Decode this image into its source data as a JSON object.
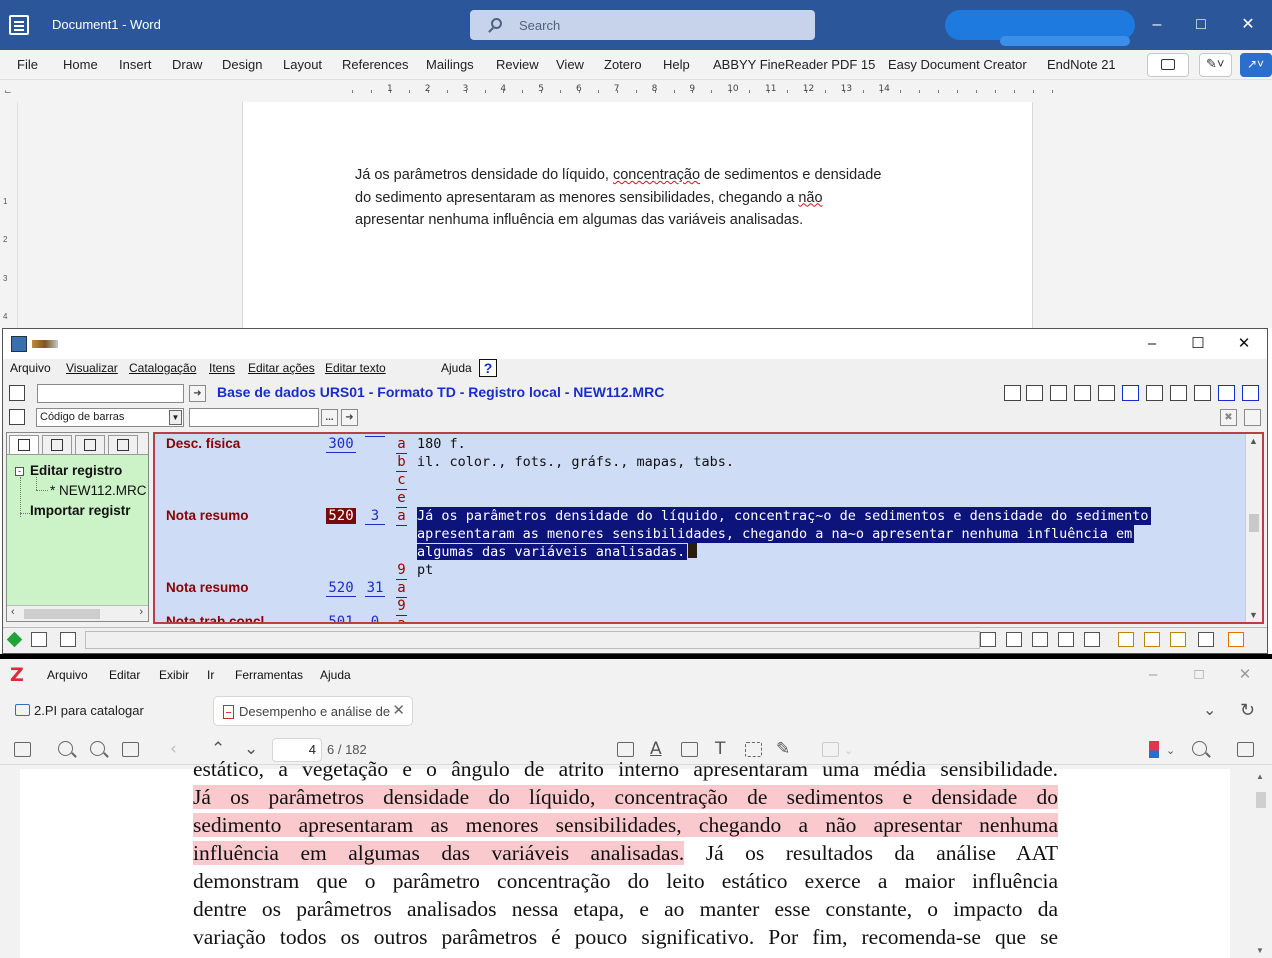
{
  "word": {
    "title": "Document1  -  Word",
    "search_placeholder": "Search",
    "menu": [
      "File",
      "Home",
      "Insert",
      "Draw",
      "Design",
      "Layout",
      "References",
      "Mailings",
      "Review",
      "View",
      "Zotero",
      "Help",
      "ABBYY FineReader PDF 15",
      "Easy Document Creator",
      "EndNote 21"
    ],
    "ruler_numbers": [
      "1",
      "2",
      "3",
      "4",
      "5",
      "6",
      "7",
      "8",
      "9",
      "10",
      "11",
      "12",
      "13",
      "14"
    ],
    "body_lines": [
      {
        "a": " Já os parâmetros densidade do líquido, ",
        "b": "concentração",
        "c": " de sedimentos e densidade"
      },
      {
        "a": "do sedimento apresentaram as menores sensibilidades, chegando a ",
        "b": "não",
        "c": ""
      },
      {
        "a": "apresentar nenhuma influência em algumas das variáveis analisadas.",
        "b": "",
        "c": ""
      }
    ]
  },
  "catalog": {
    "menu": [
      "Arquivo",
      "Visualizar",
      "Catalogação",
      "Itens",
      "Editar ações",
      "Editar texto",
      "Ajuda"
    ],
    "help_symbol": "?",
    "db_title": "Base de dados URS01 - Formato TD - Registro local - NEW112.MRC",
    "search_field_select": "Código de barras",
    "search_button": "...",
    "tree": {
      "edit": "Editar registro",
      "record": "* NEW112.MRC",
      "import": "Importar registr"
    },
    "fields": [
      {
        "label": "Desc. física",
        "tag": "300",
        "ind": "",
        "subs": [
          "a",
          "b",
          "c",
          "e"
        ],
        "values": [
          "180 f.",
          "il. color., fots., gráfs., mapas, tabs."
        ]
      },
      {
        "label": "Nota resumo",
        "tag": "520",
        "ind": "3",
        "subs": [
          "a"
        ],
        "values": [
          "Já os parâmetros densidade do líquido, concentraç~o de sedimentos e densidade do sedimento",
          "apresentaram as menores sensibilidades, chegando a na~o apresentar nenhuma influência em",
          "algumas das variáveis analisadas."
        ]
      },
      {
        "label": "",
        "tag": "",
        "ind": "",
        "subs": [
          "9"
        ],
        "values": [
          "pt"
        ]
      },
      {
        "label": "Nota resumo",
        "tag": "520",
        "ind": "31",
        "subs": [
          "a",
          "9"
        ],
        "values": []
      },
      {
        "label": "Nota trab.concl.",
        "tag": "501",
        "ind": "0",
        "subs": [
          "a"
        ],
        "values": []
      }
    ]
  },
  "zotero": {
    "logo": "Z",
    "menu": [
      "Arquivo",
      "Editar",
      "Exibir",
      "Ir",
      "Ferramentas",
      "Ajuda"
    ],
    "library_tab": "2.PI para catalogar",
    "doc_tab": "Desempenho e análise de",
    "page_current": "4",
    "page_count": "6 / 182",
    "pdf_lines": [
      {
        "pre": "estático, a vegetação e o ângulo de atrito interno apresentaram uma média sensibilidade.",
        "hl": "",
        "post": ""
      },
      {
        "pre": "",
        "hl": "Já os parâmetros densidade do líquido, concentração de sedimentos e densidade do",
        "post": ""
      },
      {
        "pre": "",
        "hl": "sedimento apresentaram as menores sensibilidades, chegando a não apresentar nenhuma",
        "post": ""
      },
      {
        "pre": "",
        "hl": "influência em algumas das variáveis analisadas.",
        "post": " Já os resultados da análise AAT"
      },
      {
        "pre": "demonstram que o parâmetro concentração do leito estático exerce a maior influência",
        "hl": "",
        "post": ""
      },
      {
        "pre": "dentre os parâmetros analisados nessa etapa, e ao manter esse constante, o impacto da",
        "hl": "",
        "post": ""
      },
      {
        "pre": "variação todos os outros parâmetros é pouco significativo. Por fim, recomenda-se que se",
        "hl": "",
        "post": ""
      }
    ],
    "highlight_color": "#f9c9cd"
  },
  "colors": {
    "word_titlebar": "#2b579a",
    "catalog_editor_bg": "#cfdcf6",
    "catalog_label": "#8a0000",
    "catalog_tag": "#1a2dc8",
    "catalog_tree_bg": "#ccf2c7",
    "selection_bg": "#0c147c",
    "zotero_logo": "#db2c3a"
  }
}
